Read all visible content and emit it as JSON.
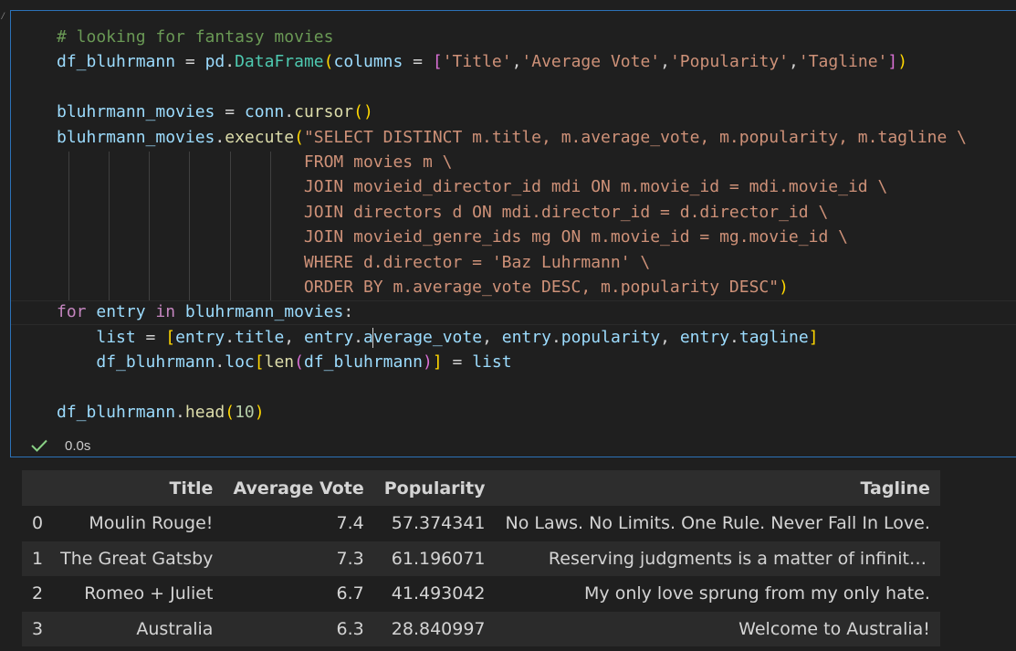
{
  "notebook": {
    "cell": {
      "code_lines": [
        "# looking for fantasy movies",
        "df_bluhrmann = pd.DataFrame(columns = ['Title','Average Vote','Popularity','Tagline'])",
        "",
        "bluhrmann_movies = conn.cursor()",
        "bluhrmann_movies.execute(\"SELECT DISTINCT m.title, m.average_vote, m.popularity, m.tagline \\",
        "                         FROM movies m \\",
        "                         JOIN movieid_director_id mdi ON m.movie_id = mdi.movie_id \\",
        "                         JOIN directors d ON mdi.director_id = d.director_id \\",
        "                         JOIN movieid_genre_ids mg ON m.movie_id = mg.movie_id \\",
        "                         WHERE d.director = 'Baz Luhrmann' \\",
        "                         ORDER BY m.average_vote DESC, m.popularity DESC\")",
        "for entry in bluhrmann_movies:",
        "    list = [entry.title, entry.average_vote, entry.popularity, entry.tagline]",
        "    df_bluhrmann.loc[len(df_bluhrmann)] = list",
        "",
        "df_bluhrmann.head(10)"
      ],
      "status": {
        "icon": "checkmark-icon",
        "exec_time": "0.0s",
        "success_color": "#89d185"
      }
    },
    "output": {
      "columns": [
        "",
        "Title",
        "Average Vote",
        "Popularity",
        "Tagline"
      ],
      "rows": [
        {
          "index": "0",
          "title": "Moulin Rouge!",
          "average_vote": "7.4",
          "popularity": "57.374341",
          "tagline": "No Laws. No Limits. One Rule. Never Fall In Love."
        },
        {
          "index": "1",
          "title": "The Great Gatsby",
          "average_vote": "7.3",
          "popularity": "61.196071",
          "tagline": "Reserving judgments is a matter of infinite ho..."
        },
        {
          "index": "2",
          "title": "Romeo + Juliet",
          "average_vote": "6.7",
          "popularity": "41.493042",
          "tagline": "My only love sprung from my only hate."
        },
        {
          "index": "3",
          "title": "Australia",
          "average_vote": "6.3",
          "popularity": "28.840997",
          "tagline": "Welcome to Australia!"
        }
      ]
    }
  },
  "theme": {
    "background": "#1f1f1f",
    "cell_border": "#2c72b8",
    "comment": "#6a9955",
    "variable": "#9cdcfe",
    "function": "#dcdcaa",
    "class": "#4ec9b0",
    "string": "#ce9178",
    "keyword": "#c586c0",
    "number": "#b5cea8"
  }
}
